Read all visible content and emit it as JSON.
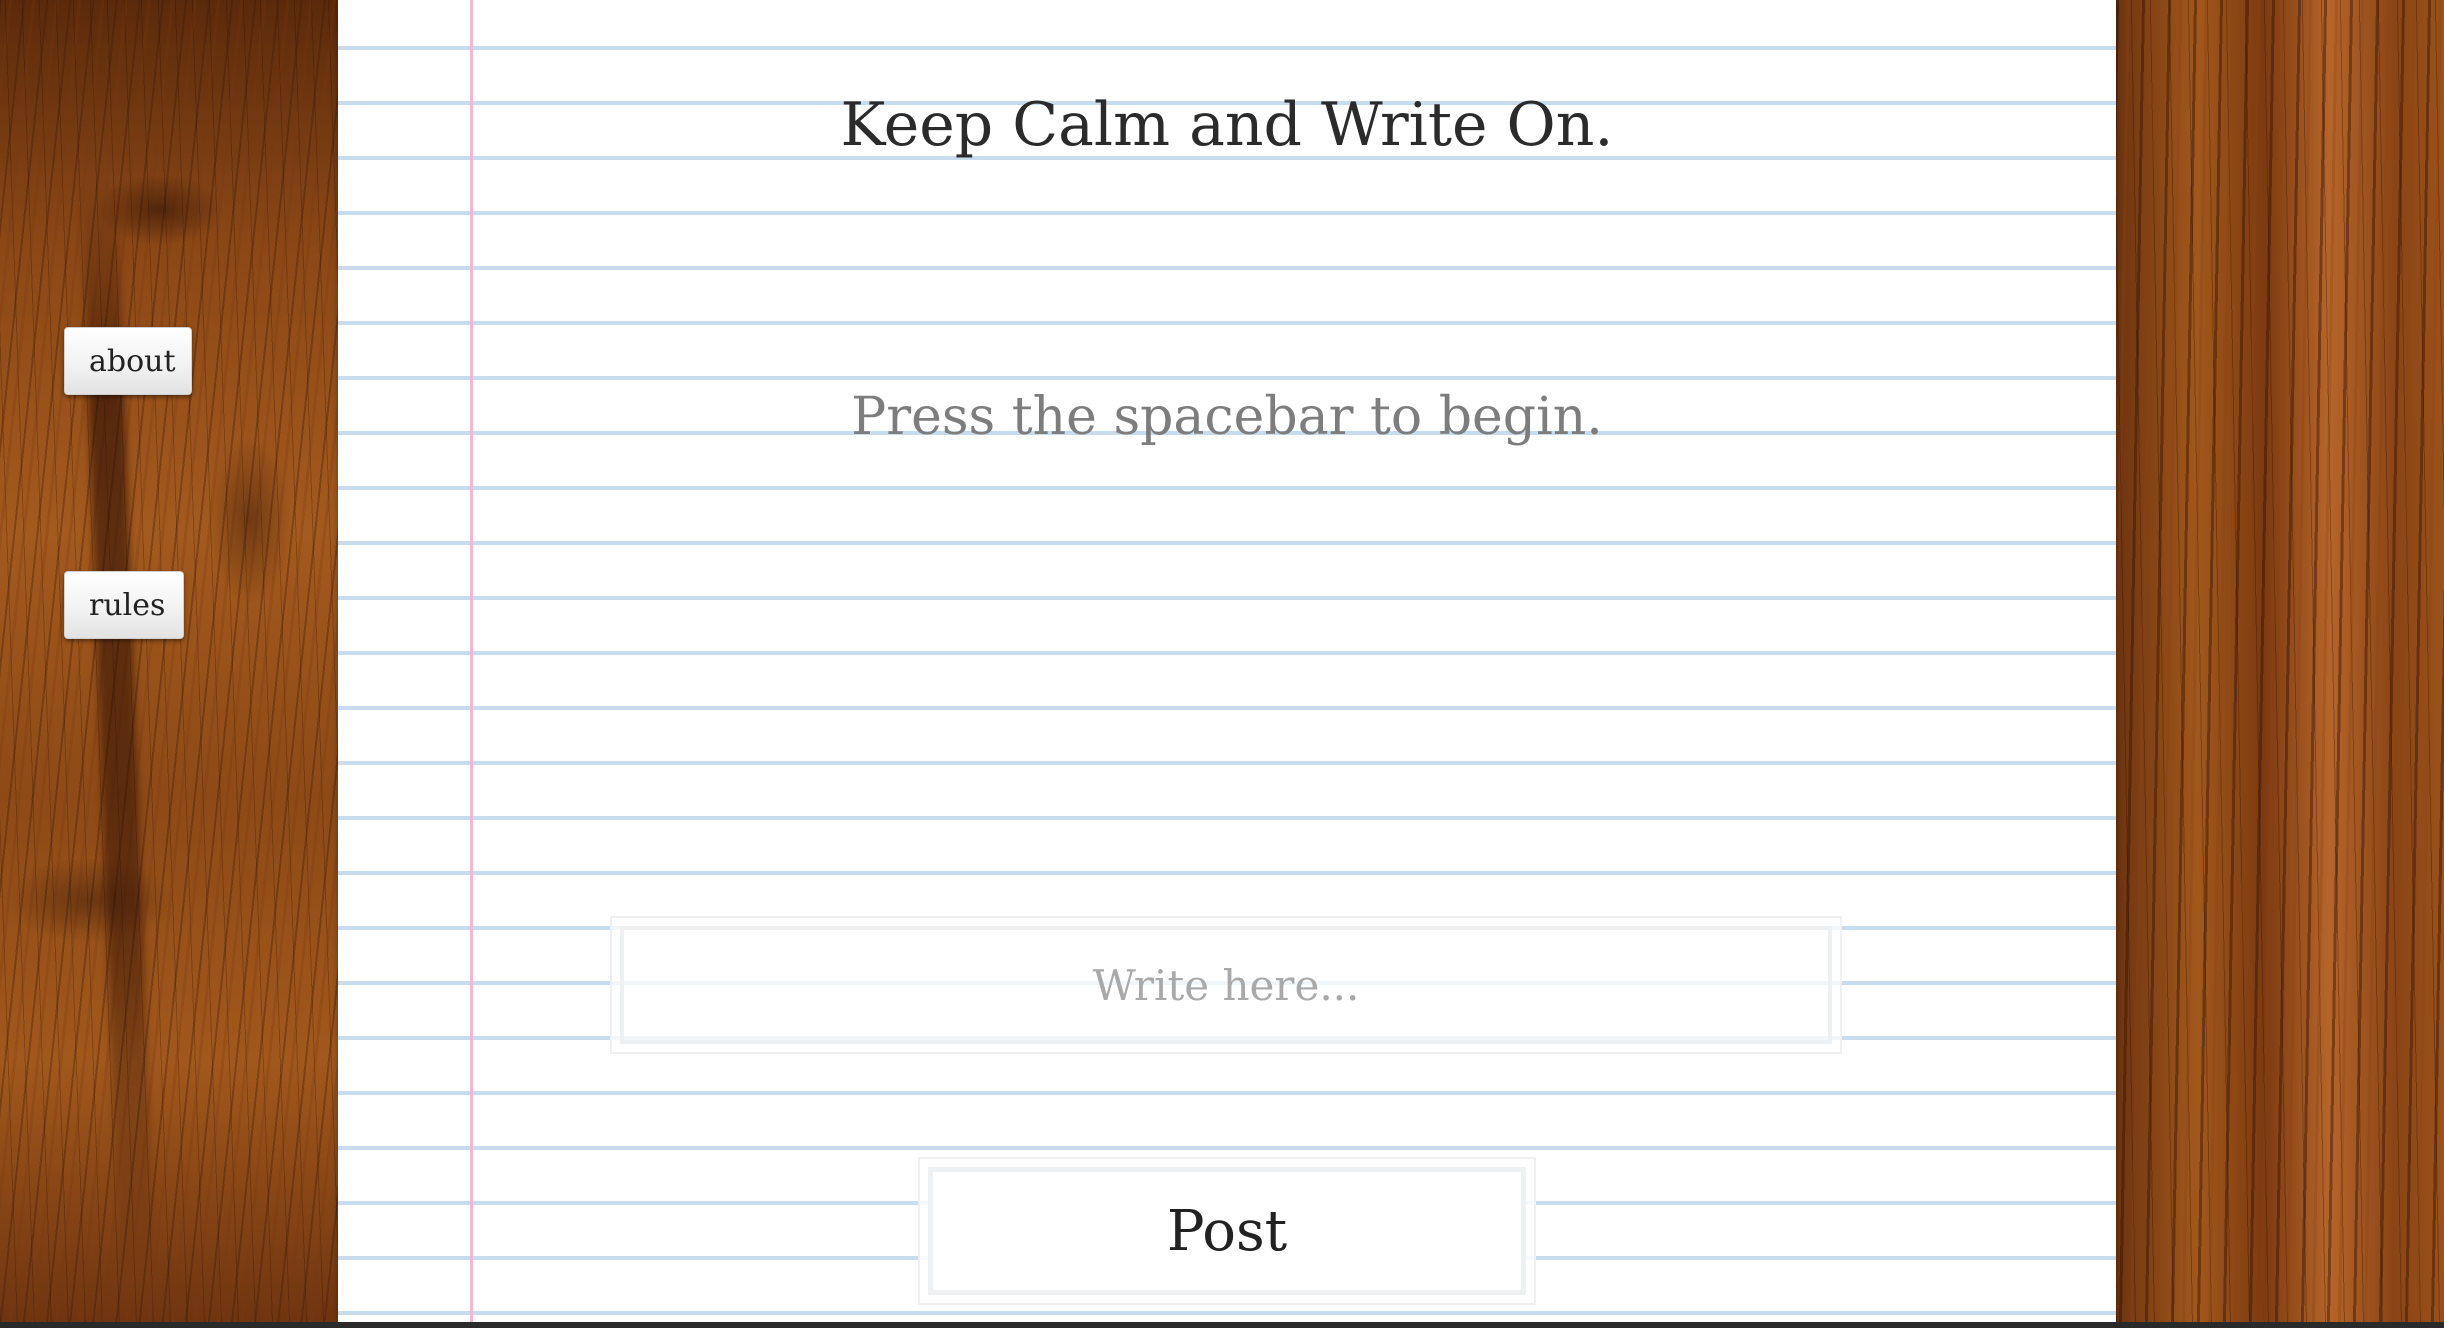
{
  "page": {
    "title": "Keep Calm and Write On.",
    "prompt": "Press the spacebar to begin."
  },
  "nav": {
    "about_label": "about",
    "rules_label": "rules"
  },
  "editor": {
    "placeholder": "Write here...",
    "value": ""
  },
  "actions": {
    "post_label": "Post"
  },
  "colors": {
    "paper": "#ffffff",
    "ruled_line": "#c8dcee",
    "margin_line": "#f2b8cf",
    "wood": "#8a4716"
  }
}
